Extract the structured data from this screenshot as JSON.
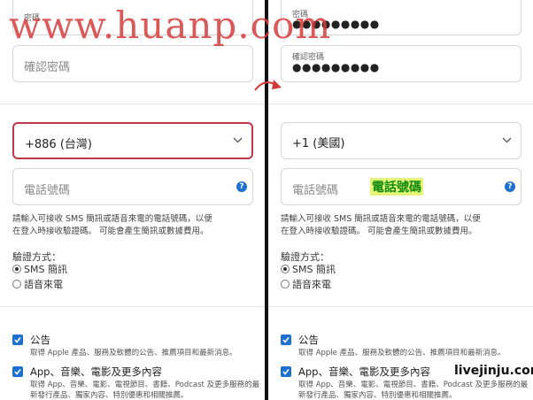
{
  "watermark": "www.huanp.com",
  "annotation": "電話號碼",
  "corner_watermark": "livejinju.com",
  "left": {
    "password_label": "密碼",
    "confirm_placeholder": "確認密碼",
    "country_value": "+886 (台灣)",
    "phone_placeholder": "電話號碼"
  },
  "right": {
    "password_label": "密碼",
    "password_dots": "●●●●●●●●●",
    "confirm_label": "確認密碼",
    "confirm_dots": "●●●●●●●●●",
    "country_value": "+1 (美國)",
    "phone_placeholder": "電話號碼"
  },
  "note_line1": "請輸入可接收 SMS 簡訊或語音來電的電話號碼，以便",
  "note_line2": "在登入時接收驗證碼。 可能會產生簡訊或數據費用。",
  "verification": {
    "title": "驗證方式：",
    "sms": "SMS 簡訊",
    "voice": "語音來電"
  },
  "announcements": {
    "title": "公告",
    "desc": "取得 Apple 產品、服務及軟體的公告、推薦項目和最新消息。"
  },
  "apps": {
    "title": "App、音樂、電影及更多內容",
    "desc": "取得 App、音樂、電影、電視節目、書籍、Podcast 及更多服務的最新發行產品、獨家內容、特別優惠和相關推薦。"
  },
  "colors": {
    "accent": "#1f6fd0",
    "focus_border": "#c0364a"
  }
}
